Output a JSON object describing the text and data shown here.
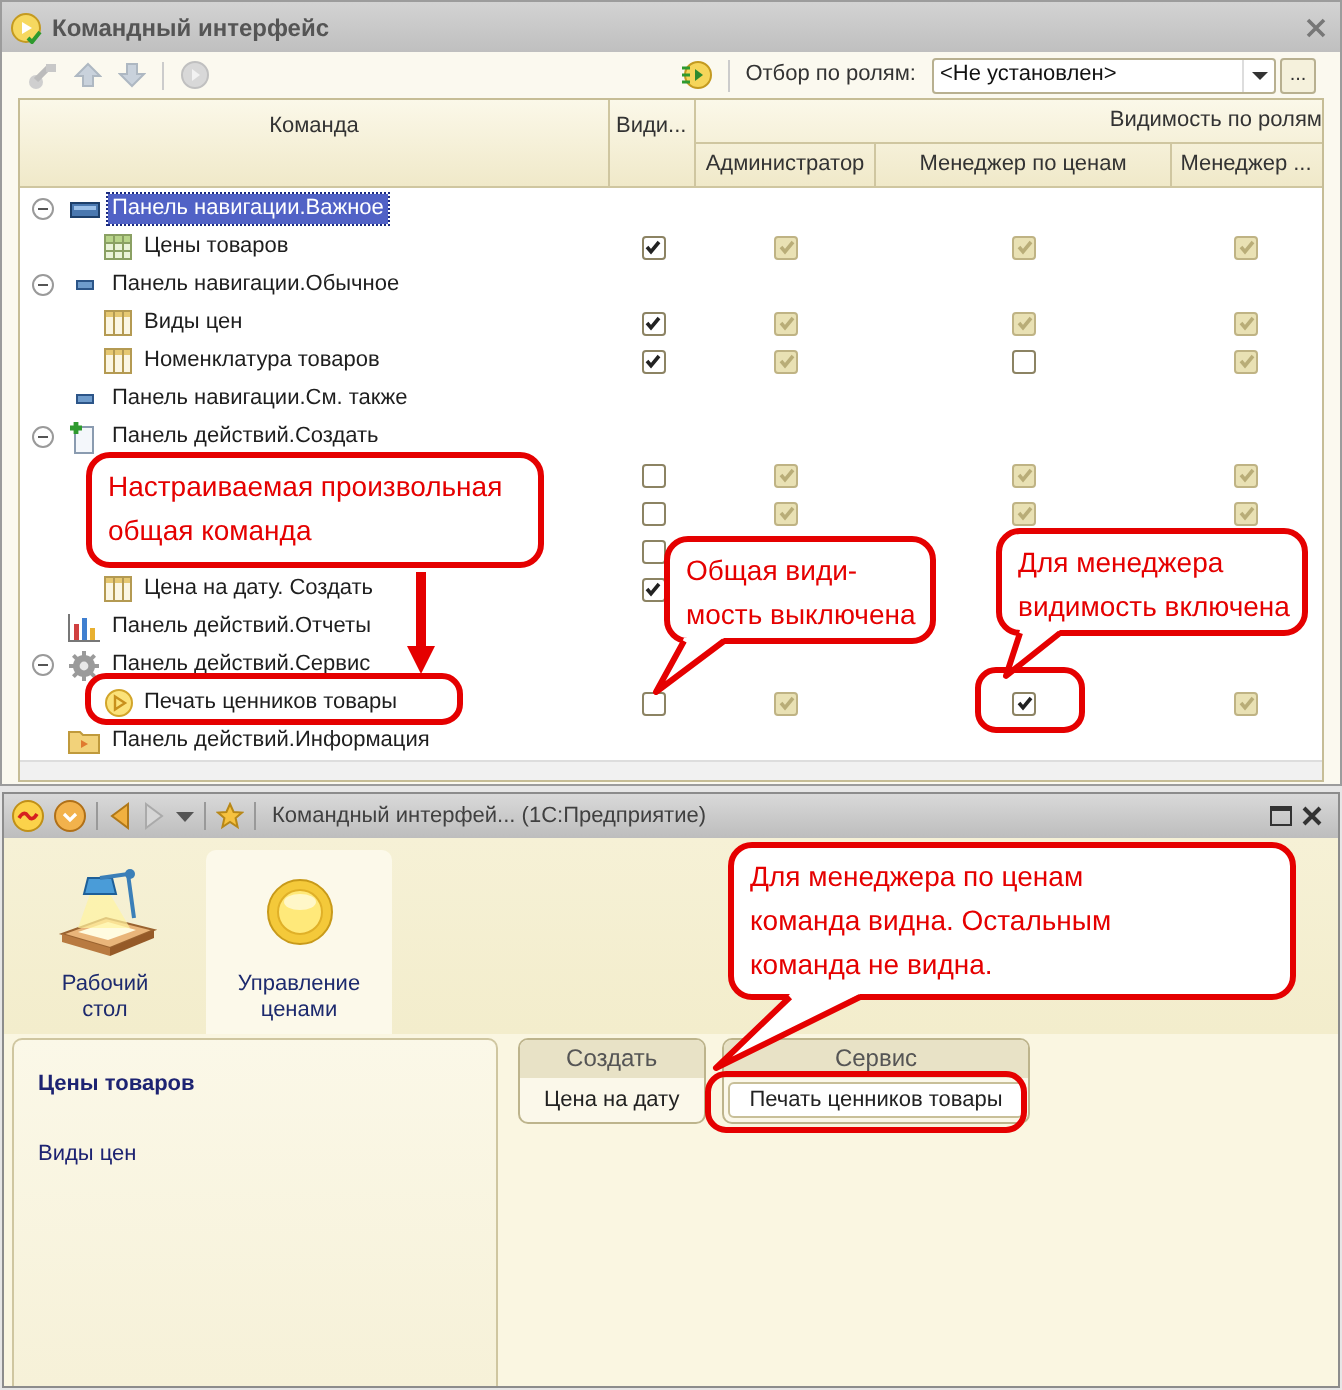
{
  "window": {
    "title": "Командный интерфейс"
  },
  "toolbar": {
    "filter_label": "Отбор по ролям:",
    "filter_value": "<Не установлен>",
    "more_button": "..."
  },
  "table": {
    "columns": {
      "command": "Команда",
      "visible": "Види...",
      "roles_group": "Видимость по ролям",
      "roles": [
        "Администратор",
        "Менеджер по ценам",
        "Менеджер ..."
      ]
    },
    "rows": [
      {
        "name": "Панель навигации.Важное",
        "kind": "panel_large",
        "selected": true,
        "expanded": true,
        "children": [
          {
            "name": "Цены товаров",
            "kind": "table",
            "visible": true,
            "roles": [
              {
                "checked": true,
                "disabled": true
              },
              {
                "checked": true,
                "disabled": true
              },
              {
                "checked": true,
                "disabled": true
              }
            ]
          }
        ]
      },
      {
        "name": "Панель навигации.Обычное",
        "kind": "panel_small",
        "selected": false,
        "expanded": true,
        "children": [
          {
            "name": "Виды цен",
            "kind": "columns",
            "visible": true,
            "roles": [
              {
                "checked": true,
                "disabled": true
              },
              {
                "checked": true,
                "disabled": true
              },
              {
                "checked": true,
                "disabled": true
              }
            ]
          },
          {
            "name": "Номенклатура товаров",
            "kind": "columns",
            "visible": true,
            "roles": [
              {
                "checked": true,
                "disabled": true
              },
              {
                "checked": false,
                "disabled": false
              },
              {
                "checked": true,
                "disabled": true
              }
            ]
          }
        ]
      },
      {
        "name": "Панель навигации.См. также",
        "kind": "panel_small",
        "selected": false
      },
      {
        "name": "Панель действий.Создать",
        "kind": "document_plus",
        "selected": false,
        "expanded": true,
        "children": [
          {
            "visible": false,
            "roles": [
              {
                "checked": true,
                "disabled": true
              },
              {
                "checked": true,
                "disabled": true
              },
              {
                "checked": true,
                "disabled": true
              }
            ]
          },
          {
            "visible": false,
            "roles": [
              {
                "checked": true,
                "disabled": true
              },
              {
                "checked": true,
                "disabled": true
              },
              {
                "checked": true,
                "disabled": true
              }
            ]
          },
          {
            "visible": false
          },
          {
            "name": "Цена на дату. Создать",
            "kind": "columns",
            "visible": true
          }
        ]
      },
      {
        "name": "Панель действий.Отчеты",
        "kind": "bar_chart",
        "selected": false
      },
      {
        "name": "Панель действий.Сервис",
        "kind": "gear",
        "selected": false,
        "expanded": true,
        "children": [
          {
            "name": "Печать ценников товары",
            "kind": "play",
            "visible": false,
            "roles": [
              {
                "checked": true,
                "disabled": true
              },
              {
                "checked": true,
                "disabled": false
              },
              {
                "checked": true,
                "disabled": true
              }
            ]
          }
        ]
      },
      {
        "name": "Панель действий.Информация",
        "kind": "folder",
        "selected": false
      }
    ]
  },
  "app_window": {
    "title": "Командный интерфей... (1С:Предприятие)",
    "sections": [
      {
        "label": "Рабочий стол",
        "kind": "desk",
        "selected": false
      },
      {
        "label": "Управление ценами",
        "kind": "coin",
        "selected": true
      }
    ],
    "navigation": [
      {
        "label": "Цены товаров",
        "selected": true
      },
      {
        "label": "Виды цен",
        "selected": false
      }
    ],
    "command_groups": [
      {
        "title": "Создать",
        "commands": [
          "Цена на дату"
        ]
      },
      {
        "title": "Сервис",
        "commands": [
          "Печать ценников товары"
        ]
      }
    ]
  },
  "callouts": [
    {
      "text": "Настраиваемая произвольная\nобщая команда"
    },
    {
      "text": "Общая види-\nмость выключена"
    },
    {
      "text": "Для менеджера\nвидимость включена"
    },
    {
      "text": "Для менеджера по ценам\nкоманда видна. Остальным\nкоманда не видна."
    }
  ]
}
